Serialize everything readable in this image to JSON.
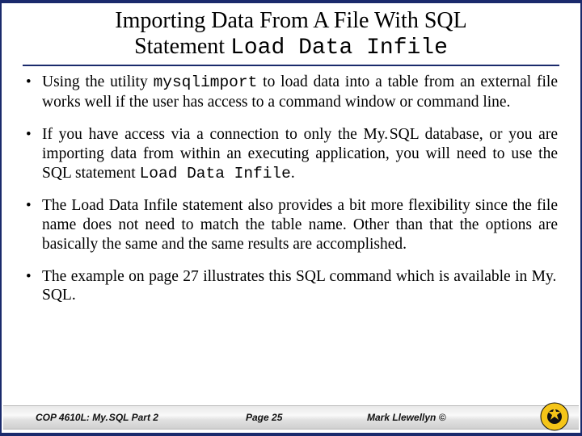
{
  "title": {
    "line1": "Importing Data From A File With SQL",
    "line2_prefix": "Statement ",
    "line2_mono": "Load Data Infile"
  },
  "bullets": {
    "b1_pre": "Using the utility ",
    "b1_mono": "mysqlimport",
    "b1_post": " to load data into a table from an external file works well if the user has access to a command window or command line.",
    "b2_pre": "If you have access via a connection to only the My. SQL database, or you are importing data from within an executing application, you will need to use the SQL statement ",
    "b2_mono": "Load Data Infile",
    "b2_post": ".",
    "b3": "The Load Data Infile statement also provides a bit more flexibility since the file name does not need to match the table name.  Other than that the options are basically the same and the same results are accomplished.",
    "b4": "The example on page 27 illustrates this SQL command which is available in My. SQL."
  },
  "footer": {
    "course": "COP 4610L: My. SQL Part 2",
    "page": "Page 25",
    "author": "Mark Llewellyn ©"
  }
}
